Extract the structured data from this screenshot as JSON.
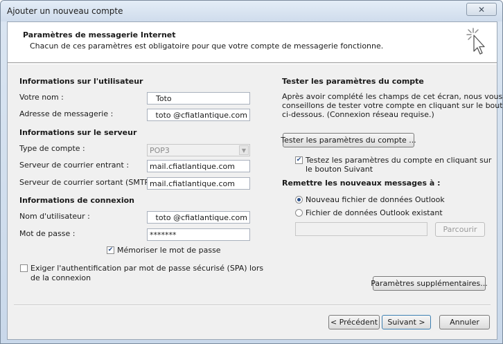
{
  "window": {
    "title": "Ajouter un nouveau compte",
    "close_glyph": "✕"
  },
  "header": {
    "title": "Paramètres de messagerie Internet",
    "subtitle": "Chacun de ces paramètres est obligatoire pour que votre compte de messagerie fonctionne."
  },
  "user_info": {
    "heading": "Informations sur l'utilisateur",
    "name_label": "Votre nom :",
    "name_value": "Toto",
    "email_label": "Adresse de messagerie :",
    "email_value": "toto @cfiatlantique.com"
  },
  "server_info": {
    "heading": "Informations sur le serveur",
    "account_type_label": "Type de compte :",
    "account_type_value": "POP3",
    "incoming_label": "Serveur de courrier entrant :",
    "incoming_value": "mail.cfiatlantique.com",
    "outgoing_label": "Serveur de courrier sortant (SMTP) :",
    "outgoing_value": "mail.cfiatlantique.com"
  },
  "login_info": {
    "heading": "Informations de connexion",
    "username_label": "Nom d'utilisateur :",
    "username_value": "toto @cfiatlantique.com",
    "password_label": "Mot de passe :",
    "password_value": "*******",
    "remember_label": "Mémoriser le mot de passe",
    "spa_label_line1": "Exiger l'authentification par mot de passe sécurisé (SPA) lors",
    "spa_label_line2": "de la connexion"
  },
  "test_section": {
    "heading": "Tester les paramètres du compte",
    "desc_line1": "Après avoir complété les champs de cet écran, nous vous",
    "desc_line2": "conseillons de tester votre compte en cliquant sur le bouton",
    "desc_line3": "ci-dessous. (Connexion réseau requise.)",
    "test_button": "Tester les paramètres du compte ...",
    "auto_test_line1": "Testez les paramètres du compte en cliquant sur",
    "auto_test_line2": "le bouton Suivant"
  },
  "deliver_section": {
    "heading": "Remettre les nouveaux messages à :",
    "option_new": "Nouveau fichier de données Outlook",
    "option_existing": "Fichier de données Outlook existant",
    "existing_path_value": "",
    "browse_button": "Parcourir"
  },
  "more_settings_button": "Paramètres supplémentaires...",
  "footer": {
    "back_button": "< Précédent",
    "next_button": "Suivant >",
    "cancel_button": "Annuler"
  },
  "state": {
    "remember_password": true,
    "require_spa": false,
    "auto_test": true,
    "deliver_new_file": true
  },
  "colors": {
    "accent": "#2a4f8a",
    "title_bar": "#cfdcec",
    "dialog_bg": "#f0f0f0"
  }
}
